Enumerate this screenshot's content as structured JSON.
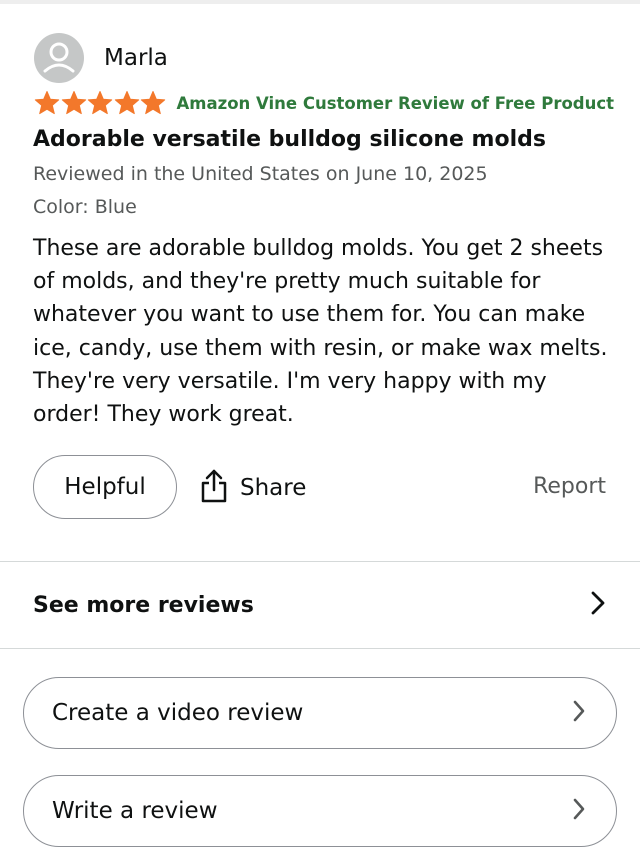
{
  "review": {
    "reviewer_name": "Marla",
    "rating": 5,
    "rating_max": 5,
    "star_color": "#f3782b",
    "vine_badge": "Amazon Vine Customer Review of Free Product",
    "vine_color": "#2f7a3c",
    "title": "Adorable versatile bulldog silicone molds",
    "reviewed_in": "Reviewed in the United States on June 10, 2025",
    "variant": "Color: Blue",
    "body": "These are adorable bulldog molds. You get 2 sheets of molds, and they're pretty much suitable for whatever you want to use them for. You can make ice, candy, use them with resin, or make wax melts. They're very versatile. I'm very happy with my order! They work great."
  },
  "actions": {
    "helpful_label": "Helpful",
    "share_label": "Share",
    "report_label": "Report"
  },
  "see_more": {
    "label": "See more reviews"
  },
  "buttons": {
    "video_review_label": "Create a video review",
    "write_review_label": "Write a review"
  },
  "icons": {
    "avatar": "user-avatar-icon",
    "star": "star-icon",
    "share": "share-icon",
    "chevron": "chevron-right-icon"
  }
}
